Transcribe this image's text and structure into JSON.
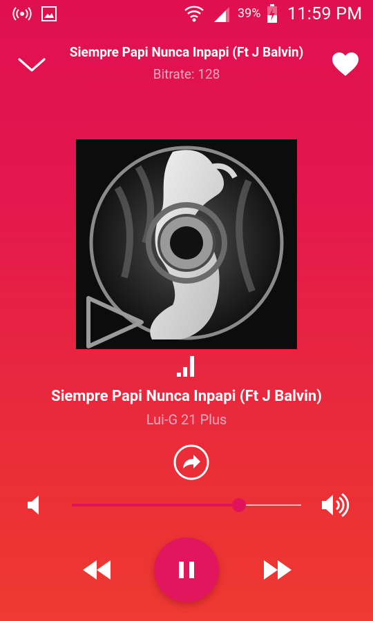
{
  "status_bar": {
    "icons": [
      "wireless-broadcast-icon",
      "image-notification-icon",
      "wifi-icon",
      "cell-signal-icon",
      "battery-charging-icon"
    ],
    "battery_percent": "39%",
    "time": "11:59 PM"
  },
  "header": {
    "title": "Siempre Papi Nunca Inpapi (Ft J Balvin)",
    "subtitle": "Bitrate: 128",
    "collapse_icon": "chevron-down-icon",
    "favorite_icon": "heart-icon"
  },
  "track": {
    "title": "Siempre Papi Nunca Inpapi (Ft J Balvin)",
    "artist": "Lui-G 21 Plus",
    "artwork_icon": "album-art-cd-dancer"
  },
  "controls": {
    "equalizer_icon": "equalizer-bars-icon",
    "share_icon": "share-icon",
    "volume_down_icon": "volume-low-icon",
    "volume_up_icon": "volume-high-icon",
    "volume_level": 0.73,
    "rewind_icon": "rewind-icon",
    "pause_icon": "pause-icon",
    "forward_icon": "fast-forward-icon"
  },
  "colors": {
    "accent": "#e0125a",
    "gradient_top": "#e0104f",
    "gradient_bottom": "#ee3a32",
    "subtext": "#f7a9c0"
  }
}
